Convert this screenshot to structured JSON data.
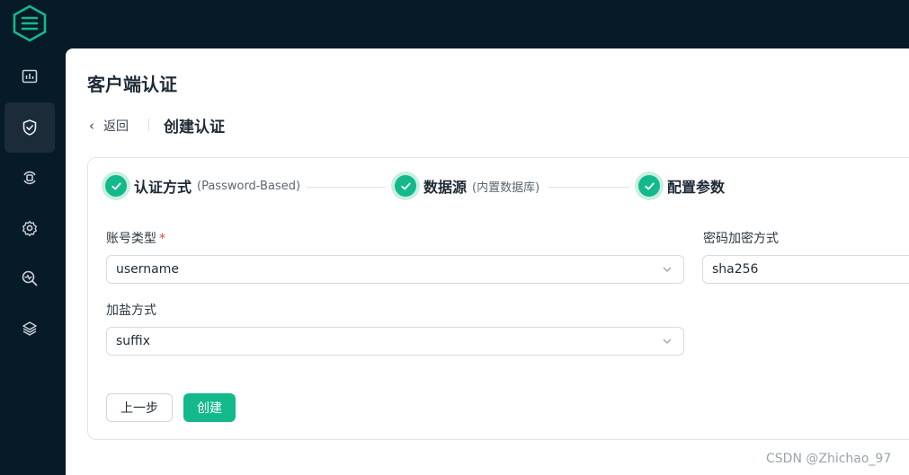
{
  "sidebar": {
    "items": [
      {
        "icon": "dashboard-icon"
      },
      {
        "icon": "shield-check-icon",
        "active": true
      },
      {
        "icon": "data-integration-icon"
      },
      {
        "icon": "settings-gear-icon"
      },
      {
        "icon": "diagnose-search-icon"
      },
      {
        "icon": "extensions-layers-icon"
      }
    ]
  },
  "page": {
    "title": "客户端认证",
    "back_label": "返回",
    "sub_title": "创建认证"
  },
  "steps": [
    {
      "title": "认证方式",
      "desc": "(Password-Based)",
      "status": "done"
    },
    {
      "title": "数据源",
      "desc": "(内置数据库)",
      "status": "done"
    },
    {
      "title": "配置参数",
      "desc": "",
      "status": "current"
    }
  ],
  "form": {
    "account_type_label": "账号类型",
    "required_mark": "*",
    "account_type_value": "username",
    "hash_label": "密码加密方式",
    "hash_value": "sha256",
    "salt_label": "加盐方式",
    "salt_value": "suffix"
  },
  "buttons": {
    "prev": "上一步",
    "create": "创建"
  },
  "watermark": "CSDN @Zhichao_97",
  "colors": {
    "primary": "#13b98b",
    "sidebar_bg": "#071a28",
    "required": "#e2453c"
  }
}
